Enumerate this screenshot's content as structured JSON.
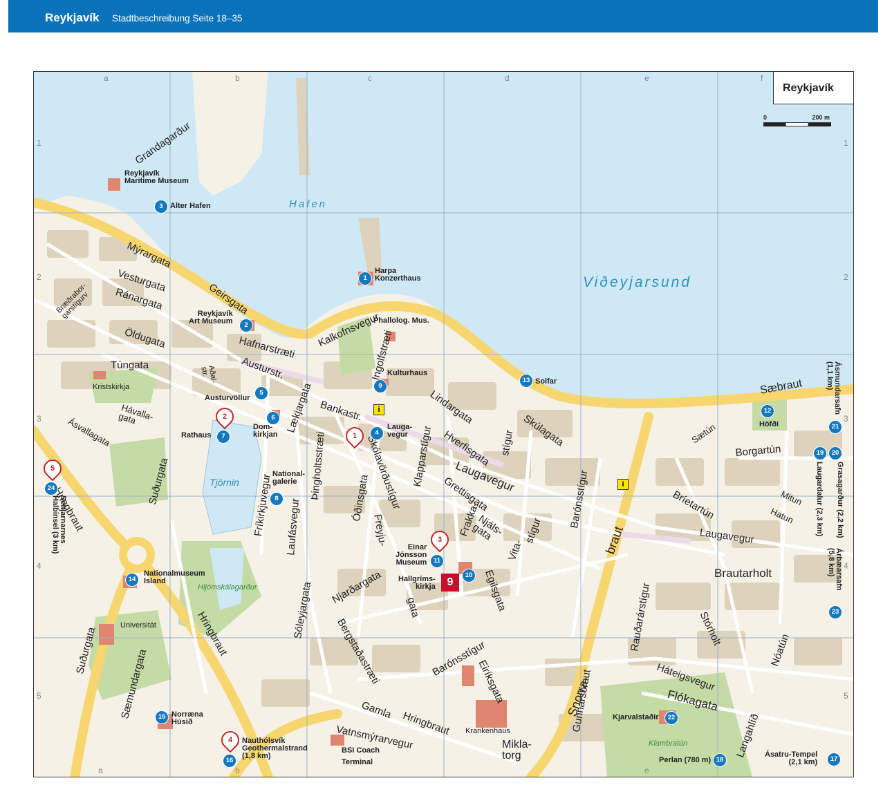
{
  "header": {
    "city": "Reykjavík",
    "subtitle": "Stadtbeschreibung Seite 18–35"
  },
  "map": {
    "title": "Reykjavík",
    "scale": {
      "start": "0",
      "end": "200 m"
    },
    "colors": {
      "water": "#cfe8f5",
      "road": "#f7d66f",
      "block": "#ddd2bc",
      "park": "#c4dba6",
      "building": "#e0856f",
      "badge": "#1478bf",
      "pin": "#c0282d"
    },
    "grid_cols": [
      "a",
      "b",
      "c",
      "d",
      "e",
      "f"
    ],
    "grid_rows": [
      "1",
      "2",
      "3",
      "4",
      "5"
    ],
    "water_labels": {
      "harbour": "Hafen",
      "sound": "Viðeyjarsund",
      "pond": "Tjörnin"
    },
    "park_labels": {
      "hljom": "Hljómskálagarður",
      "klambra": "Klambratún"
    },
    "streets": {
      "grandagardur": "Grandagarður",
      "myrargata": "Mýrargata",
      "vesturgata": "Vesturgata",
      "ranargata": "Ránargata",
      "braedra": "Bræðrabor-\ngarstígurv",
      "oldugata": "Öldugata",
      "geirsgata": "Geirsgata",
      "kalkofnsvegur": "Kalkofnsvegur",
      "tungata": "Túngata",
      "hafnarstraeti": "Hafnarstræti",
      "austurstr": "Austurstr.",
      "adalstr": "Aðal-\nstr.",
      "havallagata": "Hávalla-\ngata",
      "asvallagata": "Ásvallagata",
      "laekjargata": "Lækjargata",
      "bankastr": "Bankastr.",
      "ingolfsstraeti": "Ingolfstræti",
      "lindargata": "Lindargata",
      "hverfisgata": "Hverfisgata",
      "klapparstigur": "Klapparstígur",
      "skulagata": "Skúlagata",
      "laugavegur": "Laugavegur",
      "laugavegur2": "Laugavegur",
      "skolavordustigur": "Skólavörðustígur",
      "smidjustigur": "stígur",
      "hringbraut": "Hringbraut",
      "hringbraut2": "Hringbraut",
      "sudurgata": "Suðurgata",
      "sudurgata2": "Suðurgata",
      "frikirkjuvegur": "Fríkirkjuvegur",
      "laufasvegur": "Laufásvegur",
      "pingholtsstraeti": "Þingholtsstræti",
      "odinsgata": "Óðinsgata",
      "freyjugata": "Freyju-",
      "grettisgata": "Grettisgata",
      "frakkastigur": "Frakka-",
      "njalsgata": "Njáls-\ngata",
      "vitastigur": "Vita-",
      "vitastigur2": "stígur",
      "baronsstigur": "Barónsstígur",
      "baronsstigur2": "Barónsstígur",
      "snorrabraut": "Snorra-",
      "snorrabraut2": "braut",
      "njardargata": "Njarðargata",
      "bergstadastraeti": "Bergstaðastræti",
      "sjoleyjargata": "Sóleyjargata",
      "saemundargata": "Sæmundargata",
      "egilsgata": "Egilsgata",
      "eiriksgata": "Eiríksgata",
      "gata": "gata",
      "gamla": "Gamla",
      "gamlahring": "Hringbraut",
      "vatnsmyrar": "Vatnsmýrarvegur",
      "miklatorg": "Mikla-\ntorg",
      "saebraut": "Sæbraut",
      "saetun": "Sætún",
      "borgartun": "Borgartún",
      "brietartun": "Bríetartún",
      "mitun": "Mitun",
      "hatun": "Hatun",
      "brautarholt": "Brautarholt",
      "raudararstigur": "Rauðarárstígur",
      "stórholt": "Stórholt",
      "noatun": "Nóatún",
      "gunnarsbraut": "Gunnarsbraut",
      "hateigsvegur": "Háteigsvegur",
      "flokagata": "Flókagata",
      "langahlid": "Langahlíð"
    },
    "pois": [
      {
        "num": "1",
        "label": "Harpa\nKonzerthaus"
      },
      {
        "num": "2",
        "label": "Reykjavík\nArt Museum"
      },
      {
        "num": "3",
        "label": "Alter Hafen"
      },
      {
        "num": "4",
        "label": "Lauga-\nvegur"
      },
      {
        "num": "5",
        "label": "Austurvöllur"
      },
      {
        "num": "6",
        "label": "Dom-\nkirkjan"
      },
      {
        "num": "7",
        "label": "Rathaus"
      },
      {
        "num": "8",
        "label": "National-\ngalerie"
      },
      {
        "num": "9",
        "label": "Kulturhaus"
      },
      {
        "num": "10",
        "label": "Hallgríms-\nkirkja"
      },
      {
        "num": "11",
        "label": "Einar\nJónsson\nMuseum"
      },
      {
        "num": "12",
        "label": "Höfði"
      },
      {
        "num": "13",
        "label": "Solfar"
      },
      {
        "num": "14",
        "label": "Nationalmuseum\nIsland"
      },
      {
        "num": "15",
        "label": "Norræna\nHúsið"
      },
      {
        "num": "16",
        "label": "Nauthólsvík\nGeothermalstrand\n(1,8 km)"
      },
      {
        "num": "17",
        "label": "Ásatru-Tempel\n(2,1 km)"
      },
      {
        "num": "18",
        "label": "Perlan (780 m)"
      },
      {
        "num": "19",
        "label": "Laugardalur (2,3 km)"
      },
      {
        "num": "20",
        "label": "Grasagarður (2,2 km)"
      },
      {
        "num": "21",
        "label": "Ásmundarsafn\n(1,1 km)"
      },
      {
        "num": "22",
        "label": "Kjarvalstaðir"
      },
      {
        "num": "23",
        "label": "Árbæarsafn\n(5,8 km)"
      },
      {
        "num": "24",
        "label": "Seltjarnarnes\nHalbinsel (3 km)"
      }
    ],
    "places": {
      "maritime": "Reykjavík\nMaritime Museum",
      "phallolog": "Phallolog. Mus.",
      "kristskirkja": "Kristskirkja",
      "universitat": "Universität",
      "krankenhaus": "Krankenhaus",
      "bsi": "BSI Coach\nTerminal"
    },
    "pins": [
      "1",
      "2",
      "3",
      "4",
      "5"
    ],
    "hotspot": "9",
    "info_icon": "i"
  }
}
